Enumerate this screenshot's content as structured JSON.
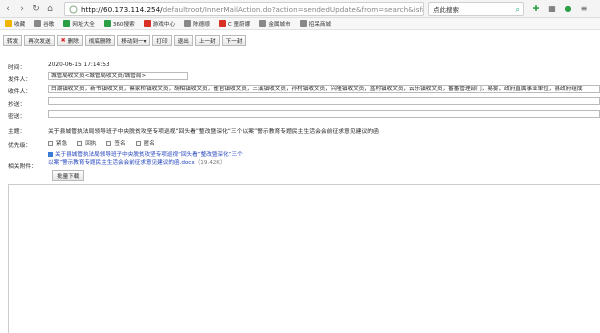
{
  "browser": {
    "url_host": "http://60.173.114.254/",
    "url_path": "defaultroot/InnerMailAction.do?action=sendedUpdate&from=search&isfr",
    "search_placeholder": "点此搜索"
  },
  "bookmarks": [
    {
      "label": "收藏",
      "color": "#f2b400"
    },
    {
      "label": "谷歌",
      "color": "#888888"
    },
    {
      "label": "网址大全",
      "color": "#2c9f45"
    },
    {
      "label": "360搜索",
      "color": "#2c9f45"
    },
    {
      "label": "游戏中心",
      "color": "#d93025"
    },
    {
      "label": "陈德顺",
      "color": "#888888"
    },
    {
      "label": "C 童蔚娜",
      "color": "#d93025"
    },
    {
      "label": "金属城市",
      "color": "#888888"
    },
    {
      "label": "招呆商城",
      "color": "#888888"
    }
  ],
  "toolbar": {
    "buttons": [
      "转发",
      "再次发送",
      "删除",
      "彻底删除",
      "移动到一▾",
      "打印",
      "退出",
      "上一封",
      "下一封"
    ]
  },
  "mail": {
    "time_label": "时间：",
    "time_value": "2020-06-15 17:14:53",
    "sender_label": "发件人：",
    "sender_value": "城管局收文员<城管局收文员/城管局>",
    "recipient_label": "收件人：",
    "recipient_value": "白湖镇收文员，新书镇收文员，蔡家桥镇收文员，胡柏镇收文员，雀官镇收文员，三溪镇收文员，孙村镇收文员，兴隆镇收文员，盆村镇收文员，云乐镇收文员，番番管理部门，易雾，政府直属事业单位，县政府组成",
    "cc_label": "抄送：",
    "cc_value": "",
    "bcc_label": "密送：",
    "bcc_value": "",
    "subject_label": "主题：",
    "subject_value": "关于县城管执法局领导班子中央脱贫攻坚专项巡视“回头看”整改暨深化“三个以案”警示教育专题民主生活会会前征求意见建议的函",
    "priority_label": "优先级：",
    "priority_options": [
      "紧急",
      "回执",
      "签名",
      "匿名"
    ],
    "attachment_label": "相关附件：",
    "attachment_line1": "关于县城管执法局领导班子中央脱贫攻坚专项巡视“回头看”整改暨深化“三个",
    "attachment_line2": "以案”警示教育专题民主生活会会前征求意见建议的函.docx",
    "attachment_size": "（19.42K）",
    "bulk_download": "批量下载"
  }
}
